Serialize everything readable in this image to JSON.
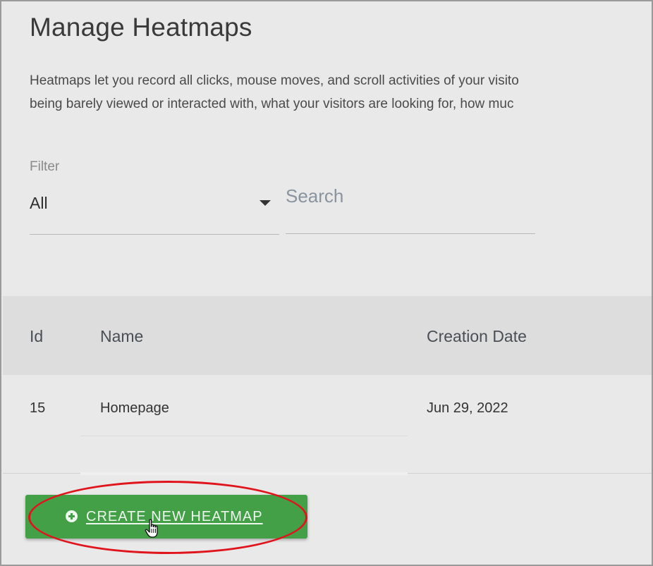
{
  "page": {
    "title": "Manage Heatmaps",
    "description_line1": "Heatmaps let you record all clicks, mouse moves, and scroll activities of your visito",
    "description_line2": "being barely viewed or interacted with, what your visitors are looking for, how muc"
  },
  "filter": {
    "label": "Filter",
    "selected": "All",
    "search_placeholder": "Search"
  },
  "table": {
    "columns": [
      "Id",
      "Name",
      "Creation Date"
    ],
    "rows": [
      {
        "id": "15",
        "name": "Homepage",
        "creation_date": "Jun 29, 2022"
      }
    ]
  },
  "actions": {
    "create_label": "CREATE NEW HEATMAP",
    "create_icon": "plus-circle-icon",
    "button_color": "#43a047",
    "highlight_color": "#e0141c"
  }
}
